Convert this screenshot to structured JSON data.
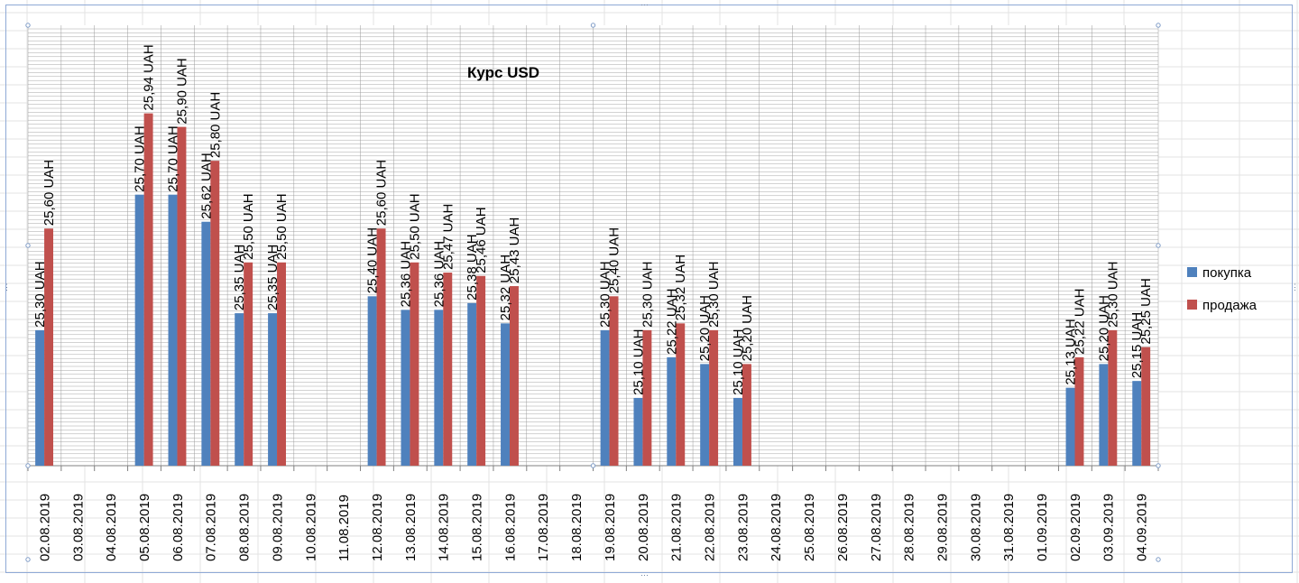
{
  "chart_data": {
    "type": "bar",
    "title": "Курс USD",
    "xlabel": "",
    "ylabel": "",
    "categories": [
      "02.08.2019",
      "03.08.2019",
      "04.08.2019",
      "05.08.2019",
      "06.08.2019",
      "07.08.2019",
      "08.08.2019",
      "09.08.2019",
      "10.08.2019",
      "11.08.2019",
      "12.08.2019",
      "13.08.2019",
      "14.08.2019",
      "15.08.2019",
      "16.08.2019",
      "17.08.2019",
      "18.08.2019",
      "19.08.2019",
      "20.08.2019",
      "21.08.2019",
      "22.08.2019",
      "23.08.2019",
      "24.08.2019",
      "25.08.2019",
      "26.08.2019",
      "27.08.2019",
      "28.08.2019",
      "29.08.2019",
      "30.08.2019",
      "31.08.2019",
      "01.09.2019",
      "02.09.2019",
      "03.09.2019",
      "04.09.2019"
    ],
    "series": [
      {
        "name": "покупка",
        "color": "#4f81bd",
        "values": [
          25.3,
          null,
          null,
          25.7,
          25.7,
          25.62,
          25.35,
          25.35,
          null,
          null,
          25.4,
          25.36,
          25.36,
          25.38,
          25.32,
          null,
          null,
          25.3,
          25.1,
          25.22,
          25.2,
          25.1,
          null,
          null,
          null,
          null,
          null,
          null,
          null,
          null,
          null,
          25.13,
          25.2,
          25.15
        ],
        "labels": [
          "25,30 UAH",
          "",
          "",
          "25,70 UAH",
          "25,70 UAH",
          "25,62 UAH",
          "25,35 UAH",
          "25,35 UAH",
          "",
          "",
          "25,40 UAH",
          "25,36 UAH",
          "25,36 UAH",
          "25,38 UAH",
          "25,32 UAH",
          "",
          "",
          "25,30 UAH",
          "25,10 UAH",
          "25,22 UAH",
          "25,20 UAH",
          "25,10 UAH",
          "",
          "",
          "",
          "",
          "",
          "",
          "",
          "",
          "",
          "25,13 UAH",
          "25,20 UAH",
          "25,15 UAH"
        ]
      },
      {
        "name": "продажа",
        "color": "#c0504d",
        "values": [
          25.6,
          null,
          null,
          25.94,
          25.9,
          25.8,
          25.5,
          25.5,
          null,
          null,
          25.6,
          25.5,
          25.47,
          25.46,
          25.43,
          null,
          null,
          25.4,
          25.3,
          25.32,
          25.3,
          25.2,
          null,
          null,
          null,
          null,
          null,
          null,
          null,
          null,
          null,
          25.22,
          25.3,
          25.25
        ],
        "labels": [
          "25,60 UAH",
          "",
          "",
          "25,94 UAH",
          "25,90 UAH",
          "25,80 UAH",
          "25,50 UAH",
          "25,50 UAH",
          "",
          "",
          "25,60 UAH",
          "25,50 UAH",
          "25,47 UAH",
          "25,46 UAH",
          "25,43 UAH",
          "",
          "",
          "25,40 UAH",
          "25,30 UAH",
          "25,32 UAH",
          "25,30 UAH",
          "25,20 UAH",
          "",
          "",
          "",
          "",
          "",
          "",
          "",
          "",
          "",
          "25,22 UAH",
          "25,30 UAH",
          "25,25 UAH"
        ]
      }
    ],
    "ylim": [
      24.9,
      26.2
    ],
    "axis_visible": false,
    "grid": true,
    "legend": "right"
  }
}
